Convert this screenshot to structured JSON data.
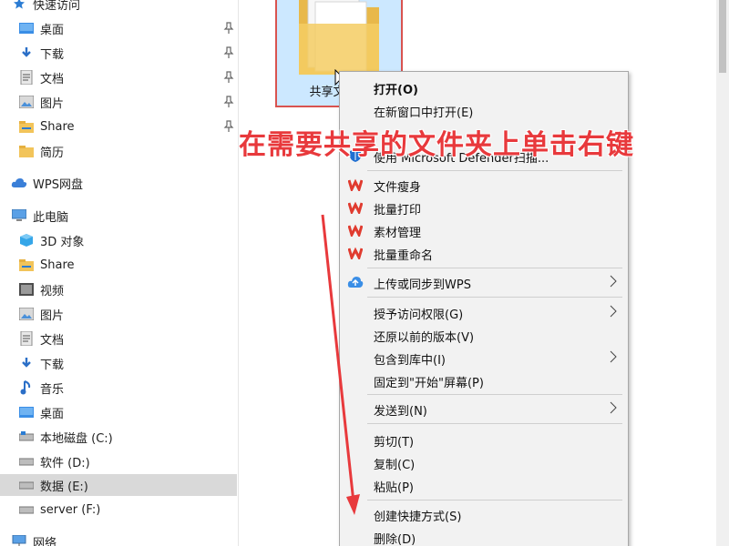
{
  "sidebar": {
    "quick_access": "快速访问",
    "items": [
      {
        "label": "桌面",
        "icon": "desktop-icon",
        "pinned": true
      },
      {
        "label": "下载",
        "icon": "download-icon",
        "pinned": true
      },
      {
        "label": "文档",
        "icon": "document-icon",
        "pinned": true
      },
      {
        "label": "图片",
        "icon": "picture-icon",
        "pinned": true
      },
      {
        "label": "Share",
        "icon": "share-folder-icon",
        "pinned": true
      },
      {
        "label": "简历",
        "icon": "folder-icon",
        "pinned": false
      }
    ],
    "wps_drive": "WPS网盘",
    "this_pc": "此电脑",
    "pc_items": [
      {
        "label": "3D 对象",
        "icon": "3d-objects-icon"
      },
      {
        "label": "Share",
        "icon": "share-folder-icon"
      },
      {
        "label": "视频",
        "icon": "video-icon"
      },
      {
        "label": "图片",
        "icon": "picture-icon"
      },
      {
        "label": "文档",
        "icon": "document-icon"
      },
      {
        "label": "下载",
        "icon": "download-icon"
      },
      {
        "label": "音乐",
        "icon": "music-icon"
      },
      {
        "label": "桌面",
        "icon": "desktop-icon"
      },
      {
        "label": "本地磁盘 (C:)",
        "icon": "drive-icon"
      },
      {
        "label": "软件 (D:)",
        "icon": "drive-icon"
      },
      {
        "label": "数据 (E:)",
        "icon": "drive-icon",
        "selected": true
      },
      {
        "label": "server (F:)",
        "icon": "drive-icon"
      }
    ],
    "network": "网络"
  },
  "content": {
    "folder_name": "共享文件夹"
  },
  "context_menu": {
    "items": [
      {
        "label": "打开(O)",
        "bold": true
      },
      {
        "label": "在新窗口中打开(E)"
      },
      {
        "label": "",
        "note": "partially hidden by annotation"
      },
      {
        "label": "使用 Microsoft Defender扫描...",
        "icon": "defender-shield-icon"
      },
      {
        "label": "文件瘦身",
        "icon": "wps-icon"
      },
      {
        "label": "批量打印",
        "icon": "wps-icon"
      },
      {
        "label": "素材管理",
        "icon": "wps-icon"
      },
      {
        "label": "批量重命名",
        "icon": "wps-icon"
      },
      {
        "label": "上传或同步到WPS",
        "icon": "wps-cloud-icon",
        "submenu": true
      },
      {
        "label": "授予访问权限(G)",
        "submenu": true
      },
      {
        "label": "还原以前的版本(V)"
      },
      {
        "label": "包含到库中(I)",
        "submenu": true
      },
      {
        "label": "固定到\"开始\"屏幕(P)"
      },
      {
        "label": "发送到(N)",
        "submenu": true
      },
      {
        "label": "剪切(T)"
      },
      {
        "label": "复制(C)"
      },
      {
        "label": "粘贴(P)"
      },
      {
        "label": "创建快捷方式(S)"
      },
      {
        "label": "删除(D)"
      }
    ]
  },
  "annotation": {
    "text": "在需要共享的文件夹上单击右键",
    "color": "#e8393c"
  }
}
